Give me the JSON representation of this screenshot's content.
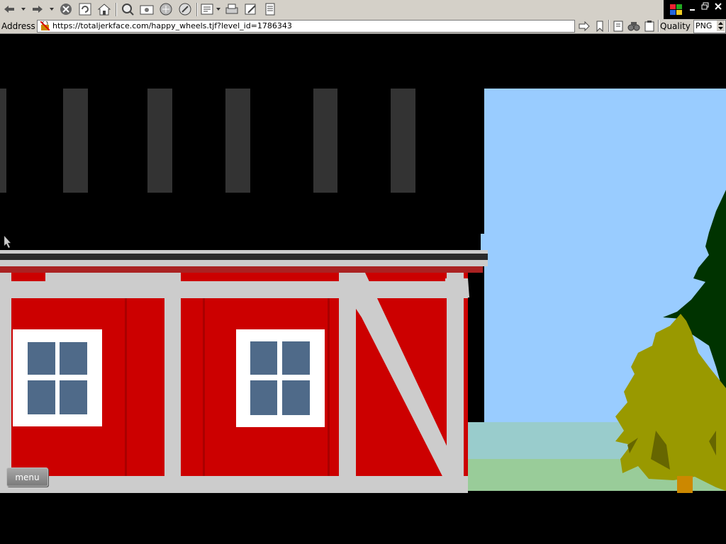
{
  "browser": {
    "toolbar_buttons": [
      "back-icon",
      "forward-icon",
      "stop-icon",
      "refresh-icon",
      "home-icon",
      "search-icon",
      "favorites-icon",
      "history-icon",
      "media-icon",
      "edit-icon",
      "print-icon",
      "edit-page-icon",
      "page-icon"
    ],
    "address_label": "Address",
    "url": "https://totaljerkface.com/happy_wheels.tjf?level_id=1786343",
    "quality_label": "Quality",
    "format_value": "PNG"
  },
  "game": {
    "menu_label": "menu",
    "colors": {
      "sky": "#99ccff",
      "barn_red": "#cc0000",
      "barn_trim": "#cccccc",
      "window_glass": "#4f6a89",
      "tree_yellow": "#999900",
      "tree_dark": "#003300",
      "grass": "#99cc99"
    }
  }
}
